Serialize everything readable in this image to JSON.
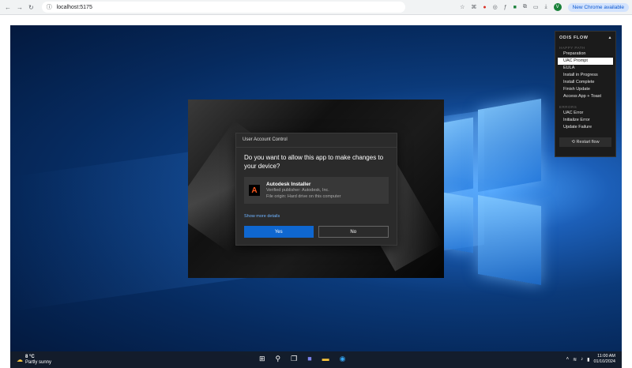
{
  "browser": {
    "url": "localhost:5175",
    "update_label": "New Chrome available",
    "profile_initial": "V"
  },
  "uac": {
    "title": "User Account Control",
    "question": "Do you want to allow this app to make changes to your device?",
    "app_name": "Autodesk Installer",
    "publisher": "Verified publisher: Autodesk, Inc.",
    "origin": "File origin: Hard drive on this computer",
    "more_details": "Show more details",
    "yes_label": "Yes",
    "no_label": "No"
  },
  "flow": {
    "title": "ODIS FLOW",
    "collapse_icon": "▴",
    "happy_label": "HAPPY PATH",
    "happy_items": [
      "Preparation",
      "UAC Prompt",
      "EULA",
      "Install in Progress",
      "Install Complete",
      "Finish Update",
      "Access App + Toast"
    ],
    "selected_index": 1,
    "errors_label": "ERRORS",
    "error_items": [
      "UAC Error",
      "Initialize Error",
      "Update Failure"
    ],
    "restart_label": "⟲ Restart flow"
  },
  "taskbar": {
    "temp": "8 °C",
    "condition": "Partly sunny",
    "time": "11:00 AM",
    "date": "01/10/2024"
  },
  "colors": {
    "accent": "#0f67d0",
    "autodesk": "#ff5a1f"
  }
}
